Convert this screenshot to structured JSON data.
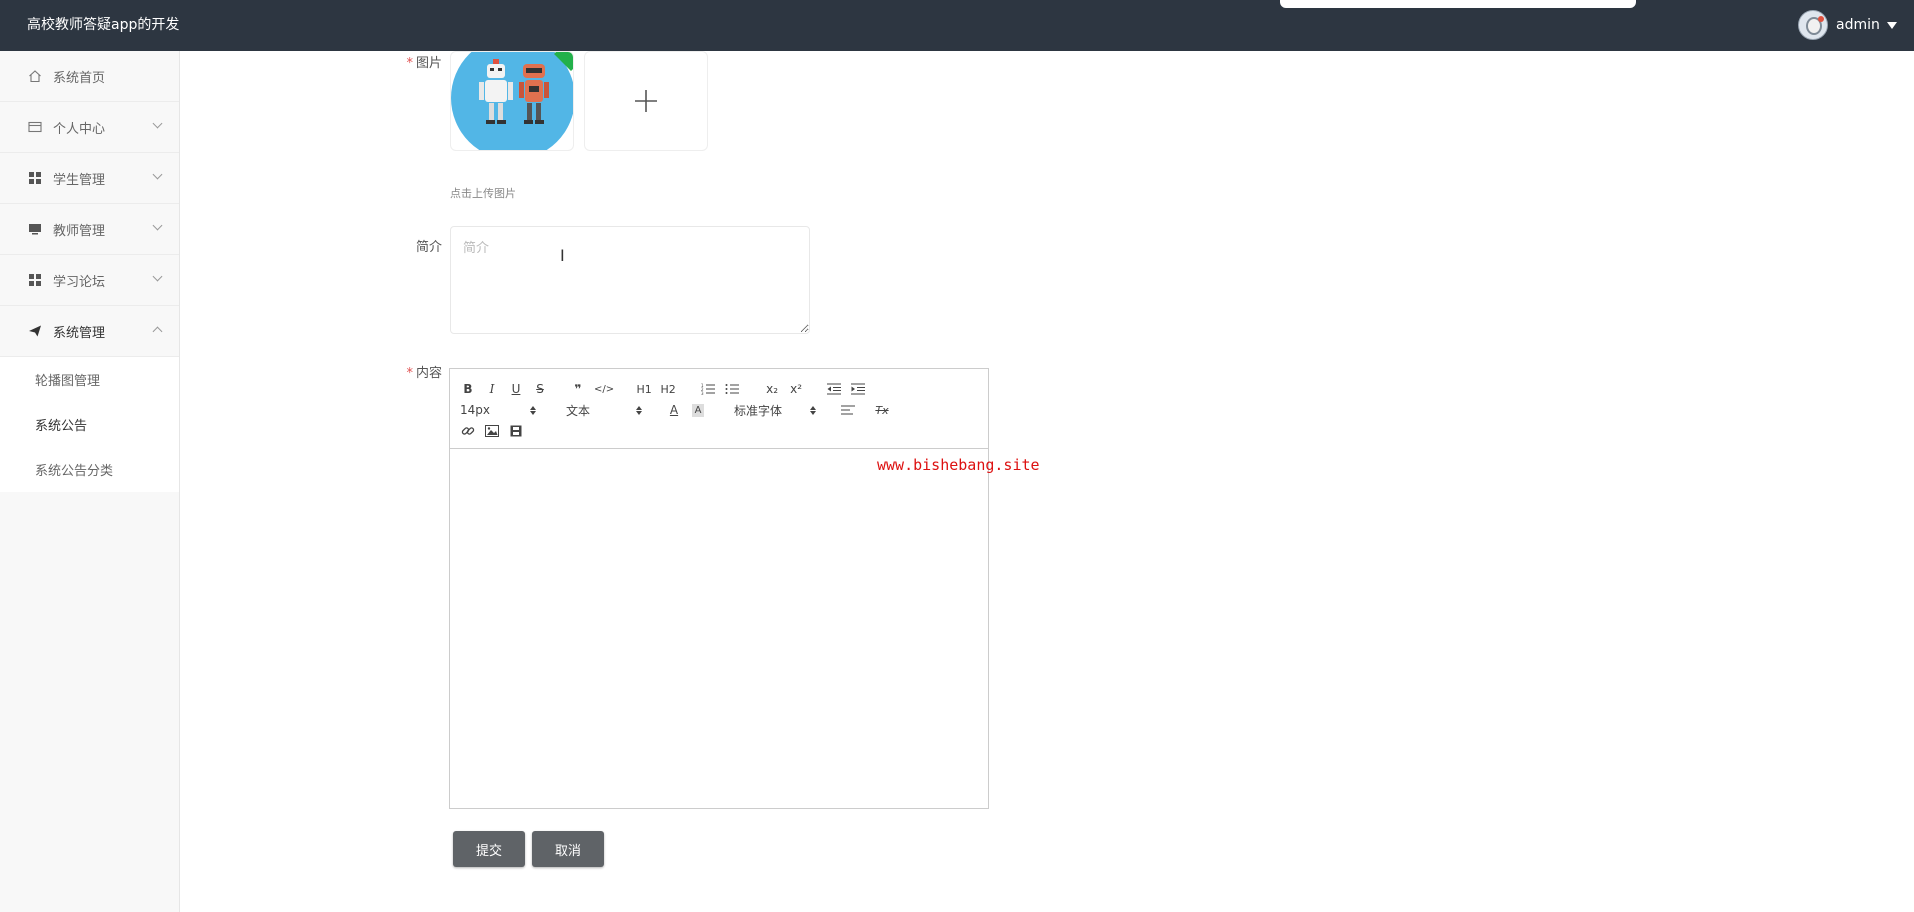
{
  "header": {
    "app_title": "高校教师答疑app的开发",
    "username": "admin"
  },
  "sidebar": {
    "items": [
      {
        "label": "系统首页",
        "icon": "home-icon"
      },
      {
        "label": "个人中心",
        "icon": "id-card-icon"
      },
      {
        "label": "学生管理",
        "icon": "grid-icon"
      },
      {
        "label": "教师管理",
        "icon": "monitor-icon"
      },
      {
        "label": "学习论坛",
        "icon": "grid-icon"
      },
      {
        "label": "系统管理",
        "icon": "paper-plane-icon"
      }
    ],
    "subitems": [
      {
        "label": "轮播图管理"
      },
      {
        "label": "系统公告"
      },
      {
        "label": "系统公告分类"
      }
    ]
  },
  "form": {
    "image_label": "图片",
    "upload_hint": "点击上传图片",
    "intro_label": "简介",
    "intro_placeholder": "简介",
    "content_label": "内容",
    "required_mark": "*",
    "submit_label": "提交",
    "cancel_label": "取消"
  },
  "editor": {
    "font_size": "14px",
    "header_select": "文本",
    "font_family": "标准字体",
    "buttons": {
      "bold": "B",
      "italic": "I",
      "underline": "U",
      "strike": "S",
      "quote": "❞",
      "code": "</>",
      "h1": "H1",
      "h2": "H2",
      "subscript": "x₂",
      "superscript": "x²",
      "color": "A",
      "background": "A",
      "clean": "Tx"
    }
  },
  "watermark": "www.bishebang.site",
  "colors": {
    "topbar": "#2d3641",
    "button": "#5f6367",
    "required": "#e05050",
    "watermark": "#dd1111"
  }
}
